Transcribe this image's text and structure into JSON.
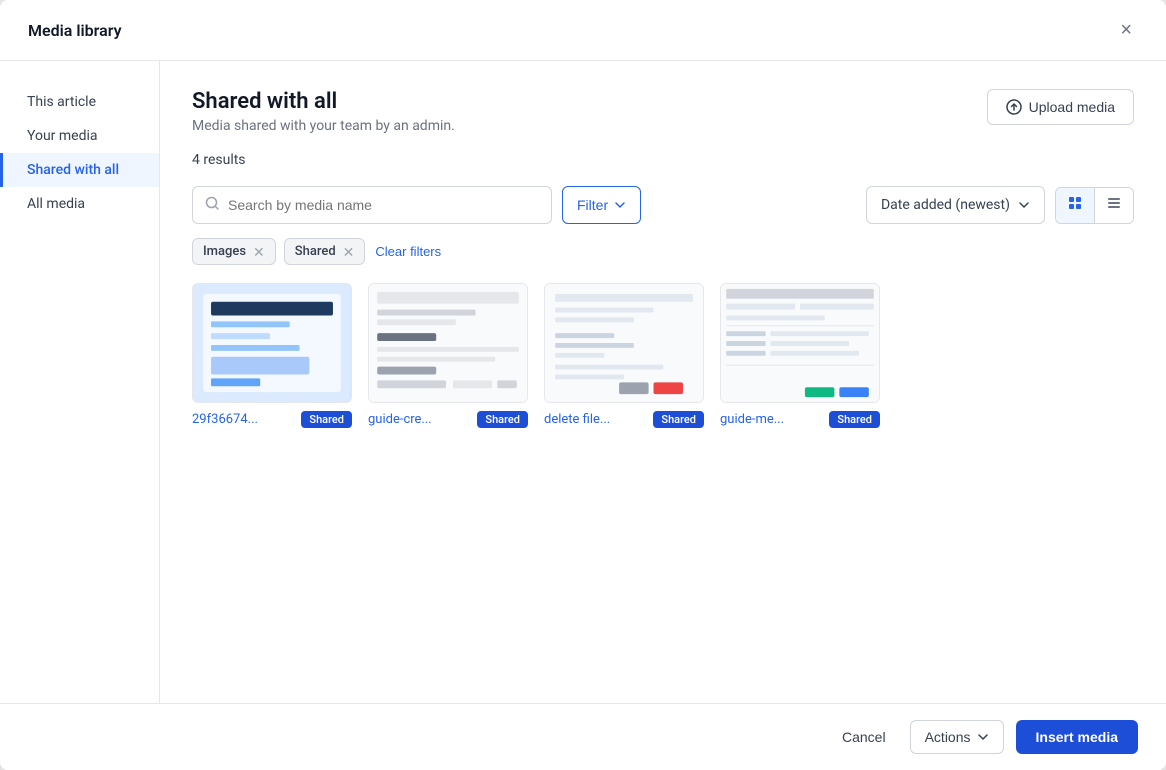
{
  "modal": {
    "title": "Media library",
    "close_label": "×"
  },
  "sidebar": {
    "items": [
      {
        "id": "this-article",
        "label": "This article",
        "active": false
      },
      {
        "id": "your-media",
        "label": "Your media",
        "active": false
      },
      {
        "id": "shared-with-all",
        "label": "Shared with all",
        "active": true
      },
      {
        "id": "all-media",
        "label": "All media",
        "active": false
      }
    ]
  },
  "main": {
    "section_title": "Shared with all",
    "section_subtitle": "Media shared with your team by an admin.",
    "results_count": "4 results",
    "upload_btn_label": "Upload media",
    "search_placeholder": "Search by media name",
    "filter_btn_label": "Filter",
    "sort_label": "Date added (newest)",
    "active_filters": [
      {
        "label": "Images",
        "removable": true
      },
      {
        "label": "Shared",
        "removable": true
      }
    ],
    "clear_filters_label": "Clear filters",
    "media_items": [
      {
        "id": "1",
        "name": "29f36674...",
        "badge": "Shared",
        "thumb_type": "1"
      },
      {
        "id": "2",
        "name": "guide-cre...",
        "badge": "Shared",
        "thumb_type": "2"
      },
      {
        "id": "3",
        "name": "delete file...",
        "badge": "Shared",
        "thumb_type": "3"
      },
      {
        "id": "4",
        "name": "guide-me...",
        "badge": "Shared",
        "thumb_type": "4"
      }
    ]
  },
  "footer": {
    "cancel_label": "Cancel",
    "actions_label": "Actions",
    "insert_label": "Insert media"
  },
  "icons": {
    "search": "🔍",
    "upload": "⬆",
    "chevron_down": "▾",
    "grid_view": "⊞",
    "list_view": "☰",
    "close": "✕",
    "filter": "▾"
  }
}
